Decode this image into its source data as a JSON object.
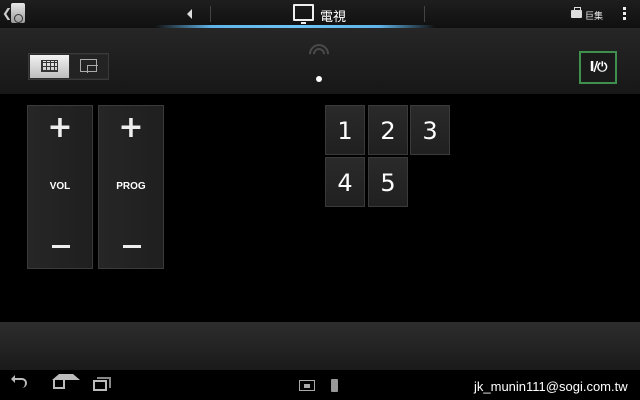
{
  "topbar": {
    "title": "電視",
    "toolbox_label": "巨集",
    "icons": {
      "back": "chevron-left-icon",
      "app": "remote-app-icon",
      "prev": "triangle-left-icon",
      "device": "tv-icon",
      "toolbox": "toolbox-icon",
      "overflow": "overflow-menu-icon"
    }
  },
  "modebar": {
    "modes": [
      "keypad",
      "touchpad"
    ],
    "selected_mode": "keypad",
    "page_indicator": {
      "pages": 1,
      "current": 1
    },
    "power_label": "I/⏻"
  },
  "rockers": [
    {
      "label": "VOL",
      "plus": "+",
      "minus": "−"
    },
    {
      "label": "PROG",
      "plus": "+",
      "minus": "−"
    }
  ],
  "numkeys": [
    "1",
    "2",
    "3",
    "4",
    "5"
  ],
  "navbar": {
    "icons": [
      "back-icon",
      "home-icon",
      "recent-apps-icon",
      "screenshot-icon",
      "remote-icon"
    ]
  },
  "watermark": "jk_munin111@sogi.com.tw",
  "colors": {
    "accent_blue": "#6ec3f5",
    "power_border": "#3f8f4f"
  }
}
